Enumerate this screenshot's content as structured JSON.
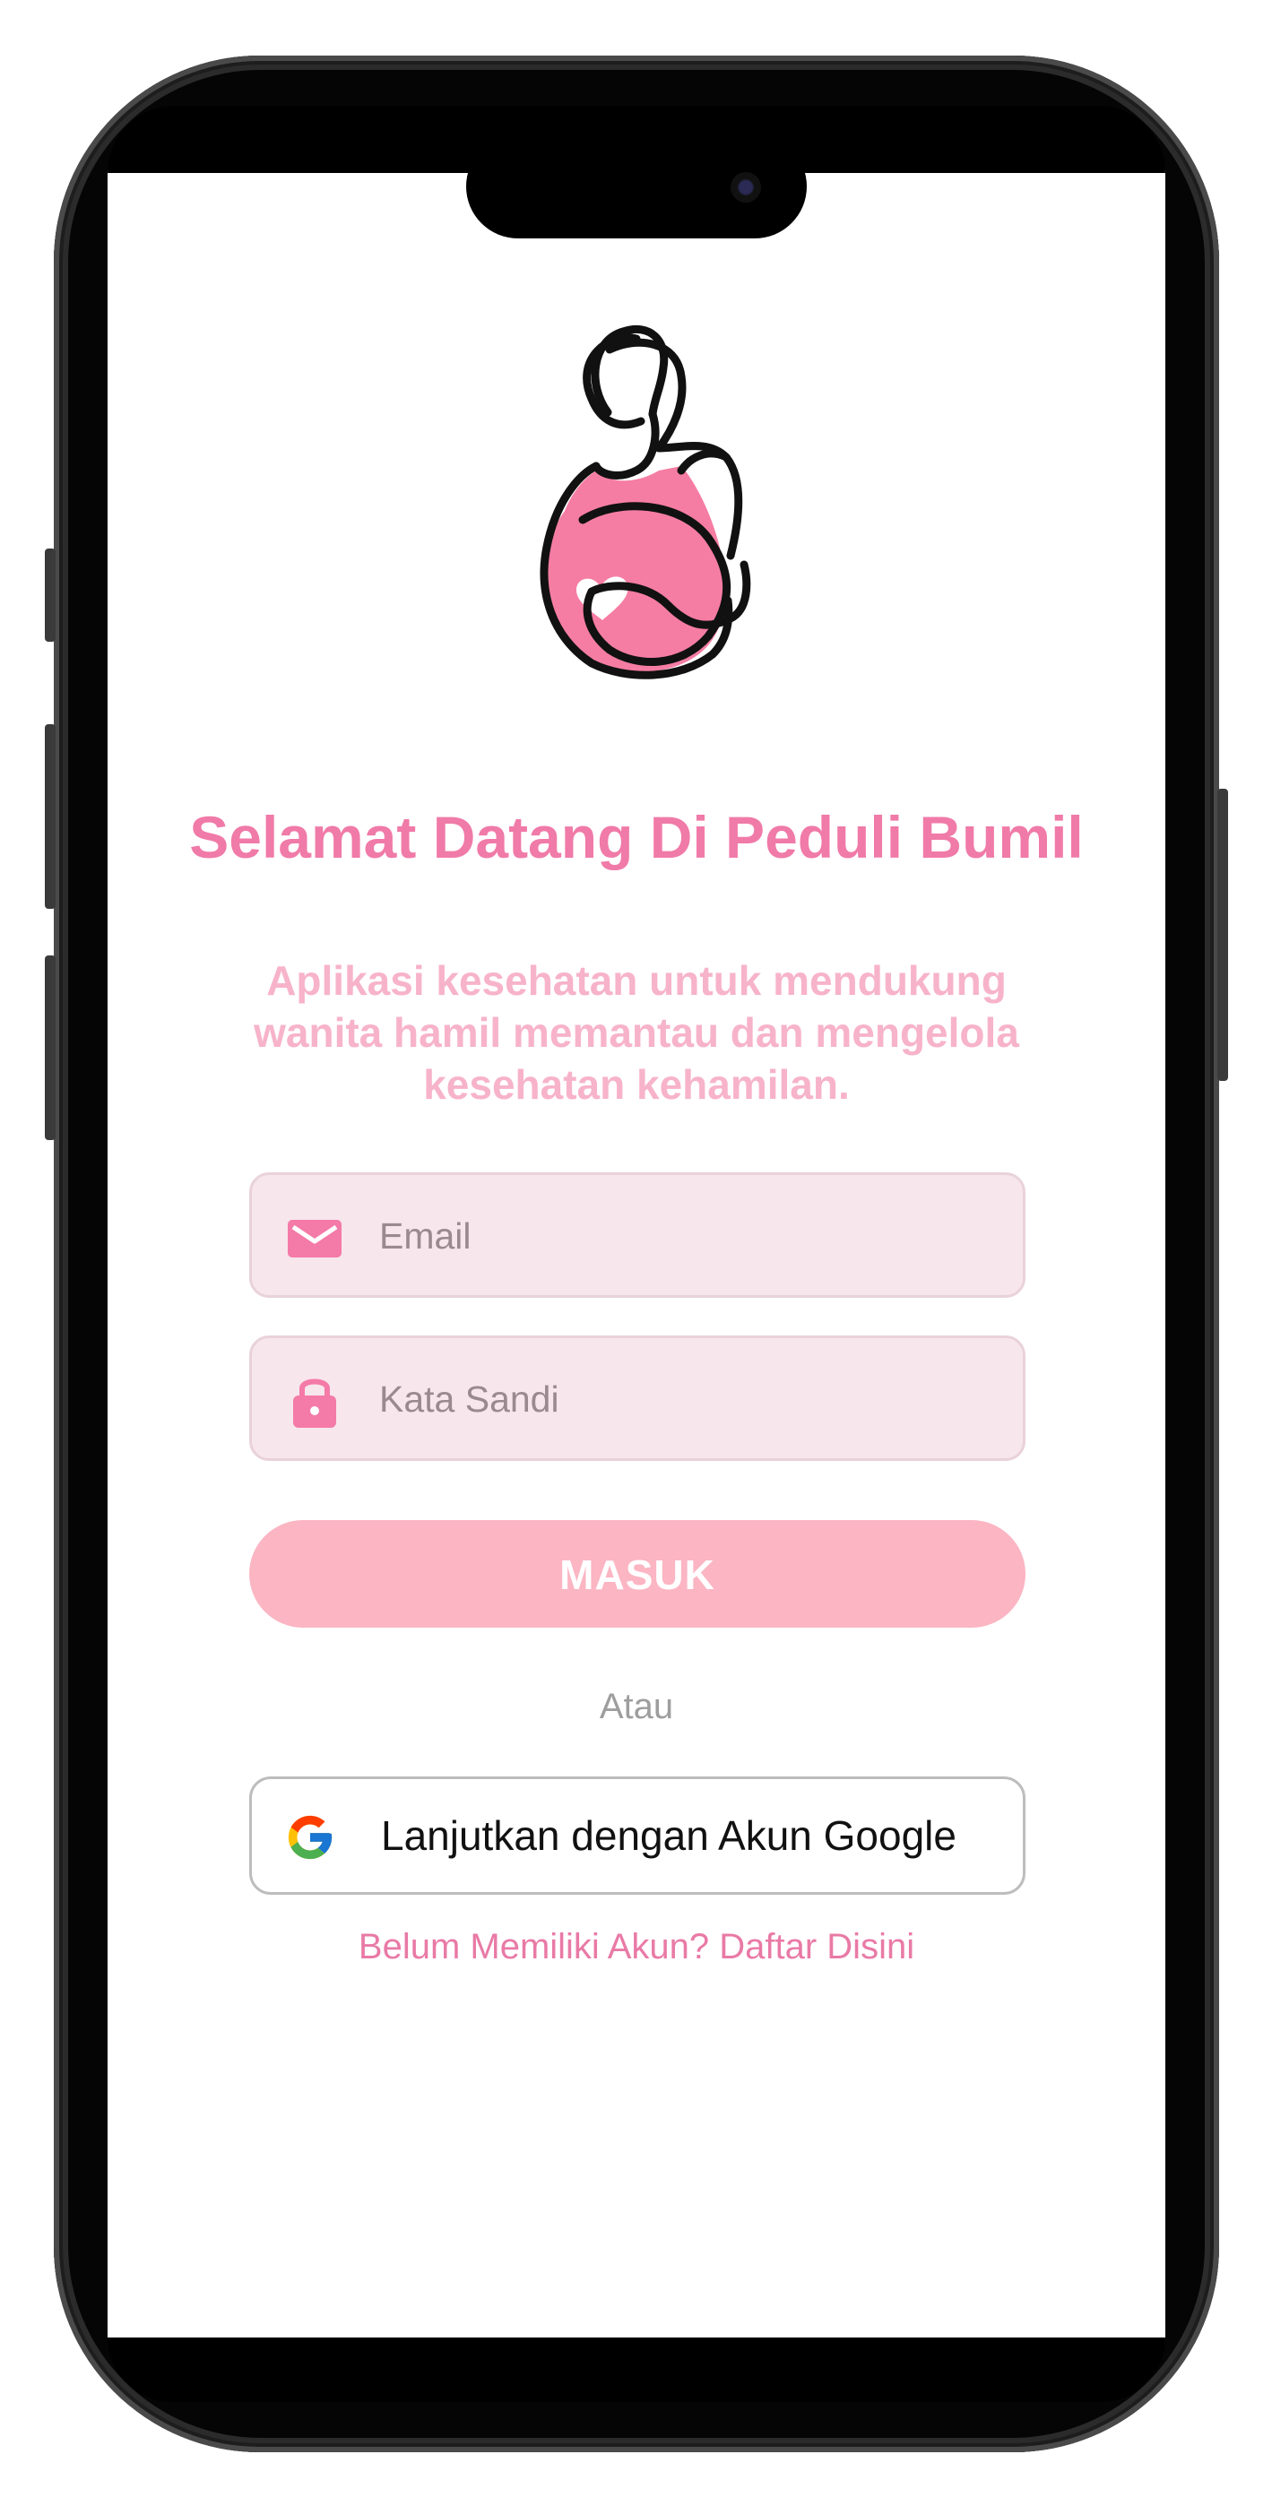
{
  "app": {
    "title": "Selamat Datang Di Peduli Bumil",
    "subtitle": "Aplikasi kesehatan untuk mendukung wanita hamil memantau dan mengelola kesehatan kehamilan.",
    "logo_icon": "pregnant-woman-icon"
  },
  "form": {
    "email": {
      "icon": "mail-icon",
      "value": "",
      "placeholder": "Email"
    },
    "password": {
      "icon": "lock-icon",
      "value": "",
      "placeholder": "Kata Sandi"
    },
    "login_label": "MASUK",
    "divider_label": "Atau",
    "google_label": "Lanjutkan dengan Akun Google",
    "google_icon": "google-icon",
    "register_label": "Belum Memiliki Akun? Daftar Disini"
  },
  "colors": {
    "primary": "#f07aa8",
    "subtitle": "#f7b3ca",
    "input_bg": "#f7e6ec",
    "icon": "#f47aa8",
    "button": "#fbb5c3",
    "muted": "#9e9e9e"
  }
}
